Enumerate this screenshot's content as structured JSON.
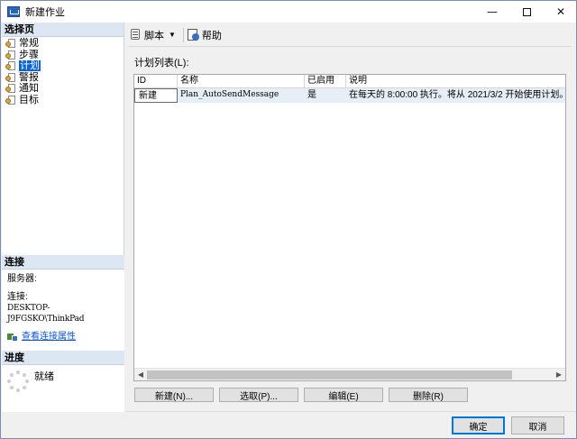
{
  "window": {
    "title": "新建作业",
    "minimize_glyph": "—",
    "close_glyph": "✕"
  },
  "left_panel": {
    "pages_header": "选择页",
    "pages": [
      {
        "label": "常规",
        "icon": "page-icon",
        "selected": false
      },
      {
        "label": "步骤",
        "icon": "page-icon",
        "selected": false
      },
      {
        "label": "计划",
        "icon": "page-icon",
        "selected": true
      },
      {
        "label": "警报",
        "icon": "page-icon",
        "selected": false
      },
      {
        "label": "通知",
        "icon": "page-icon",
        "selected": false
      },
      {
        "label": "目标",
        "icon": "page-icon",
        "selected": false
      }
    ],
    "connection": {
      "header": "连接",
      "server_label": "服务器:",
      "connection_label": "连接:",
      "connection_value": "DESKTOP-J9FGSKO\\ThinkPad",
      "view_properties_link": "查看连接属性"
    },
    "progress": {
      "header": "进度",
      "status": "就绪"
    }
  },
  "toolbar": {
    "script_label": "脚本",
    "dropdown_glyph": "▼",
    "help_label": "帮助"
  },
  "schedule_list": {
    "label": "计划列表(L):",
    "columns": [
      "ID",
      "名称",
      "已启用",
      "说明"
    ],
    "rows": [
      {
        "id": "新建",
        "name": "Plan_AutoSendMessage",
        "enabled": "是",
        "description": "在每天的 8:00:00 执行。将从 2021/3/2 开始使用计划。"
      }
    ],
    "scroll_left_glyph": "◀",
    "scroll_right_glyph": "▶"
  },
  "actions": {
    "new": "新建(N)...",
    "pick": "选取(P)...",
    "edit": "编辑(E)",
    "delete": "删除(R)"
  },
  "footer": {
    "ok": "确定",
    "cancel": "取消"
  },
  "colors": {
    "selection_blue": "#0a64d8",
    "header_band": "#dde7f3",
    "link": "#1155cc"
  }
}
